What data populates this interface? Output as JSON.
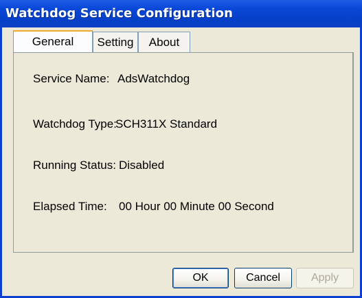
{
  "window": {
    "title": "Watchdog Service Configuration"
  },
  "tabs": [
    {
      "label": "General",
      "selected": true
    },
    {
      "label": "Setting",
      "selected": false
    },
    {
      "label": "About",
      "selected": false
    }
  ],
  "general": {
    "service_name_label": "Service Name:",
    "service_name_value": "AdsWatchdog",
    "watchdog_type_label": "Watchdog Type:",
    "watchdog_type_value": "SCH311X Standard",
    "running_status_label": "Running Status:",
    "running_status_value": "Disabled",
    "elapsed_time_label": "Elapsed Time:",
    "elapsed_time_value": "00 Hour 00 Minute 00 Second"
  },
  "buttons": {
    "ok_label": "OK",
    "cancel_label": "Cancel",
    "apply_label": "Apply",
    "apply_enabled": false
  },
  "colors": {
    "titlebar": "#0a48d8",
    "window_face": "#ece9d8",
    "selected_tab_accent": "#f0a830",
    "disabled_text": "#aca899"
  }
}
